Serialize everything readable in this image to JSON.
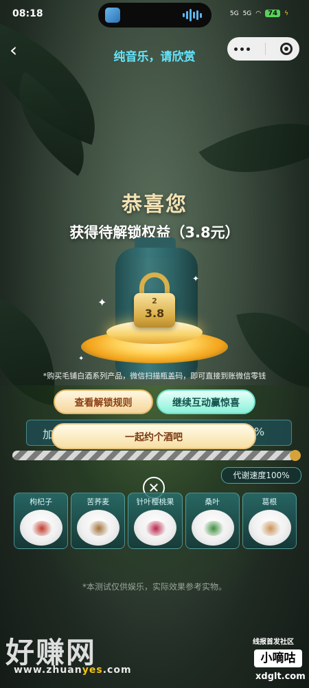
{
  "status_bar": {
    "time": "08:18",
    "signal_1": "5G",
    "signal_2": "5G",
    "battery": "74"
  },
  "header": {
    "title": "纯音乐，请欣赏"
  },
  "reward": {
    "congrats": "恭喜您",
    "benefit": "获得待解锁权益（3.8元）",
    "lock_value": "3.8",
    "lock_badge": "2"
  },
  "notice": "*购买毛铺白酒系列产品，微信扫描瓶盖码，即可直接到账微信零钱",
  "buttons": {
    "rules": "查看解锁规则",
    "continue": "继续互动赢惊喜",
    "drink": "一起约个酒吧"
  },
  "progress": {
    "left_text": "加",
    "right_text": "%",
    "fill_fraction": 0.0,
    "rate_badge": "代谢速度100%"
  },
  "ingredients": [
    {
      "name": "枸杞子",
      "color": "#c0392b"
    },
    {
      "name": "苦荞麦",
      "color": "#a0713a"
    },
    {
      "name": "针叶樱桃果",
      "color": "#b8254a"
    },
    {
      "name": "桑叶",
      "color": "#3f8d3f"
    },
    {
      "name": "葛根",
      "color": "#c9925a"
    }
  ],
  "disclaimer": "*本测试仅供娱乐，实际效果参考实物。",
  "watermark": {
    "brand": "好赚网",
    "url_pre": "www.zhuan",
    "url_mid": "yes",
    "url_post": ".com",
    "tag": "线报首发社区",
    "logo": "小嘀咕",
    "site": "xdglt.com"
  }
}
